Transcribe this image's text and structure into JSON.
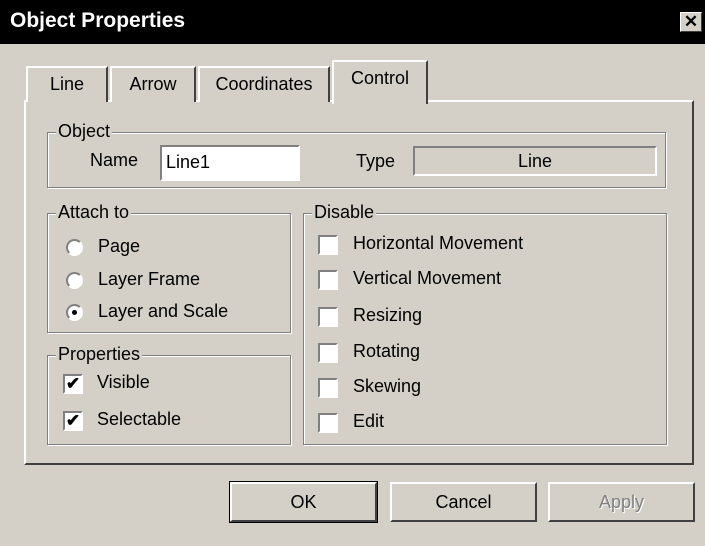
{
  "window": {
    "title": "Object Properties",
    "close_glyph": "✕"
  },
  "tabs": [
    "Line",
    "Arrow",
    "Coordinates",
    "Control"
  ],
  "active_tab": "Control",
  "object_group": {
    "title": "Object",
    "name_label": "Name",
    "name_value": "Line1",
    "type_label": "Type",
    "type_value": "Line"
  },
  "attach_group": {
    "title": "Attach to",
    "options": [
      "Page",
      "Layer Frame",
      "Layer and Scale"
    ],
    "selected": "Layer and Scale"
  },
  "properties_group": {
    "title": "Properties",
    "items": [
      {
        "label": "Visible",
        "checked": true
      },
      {
        "label": "Selectable",
        "checked": true
      }
    ]
  },
  "disable_group": {
    "title": "Disable",
    "items": [
      {
        "label": "Horizontal  Movement",
        "checked": false
      },
      {
        "label": "Vertical Movement",
        "checked": false
      },
      {
        "label": "Resizing",
        "checked": false
      },
      {
        "label": "Rotating",
        "checked": false
      },
      {
        "label": "Skewing",
        "checked": false
      },
      {
        "label": "Edit",
        "checked": false
      }
    ]
  },
  "buttons": {
    "ok": "OK",
    "cancel": "Cancel",
    "apply": "Apply",
    "apply_enabled": false
  },
  "check_glyph": "✔"
}
